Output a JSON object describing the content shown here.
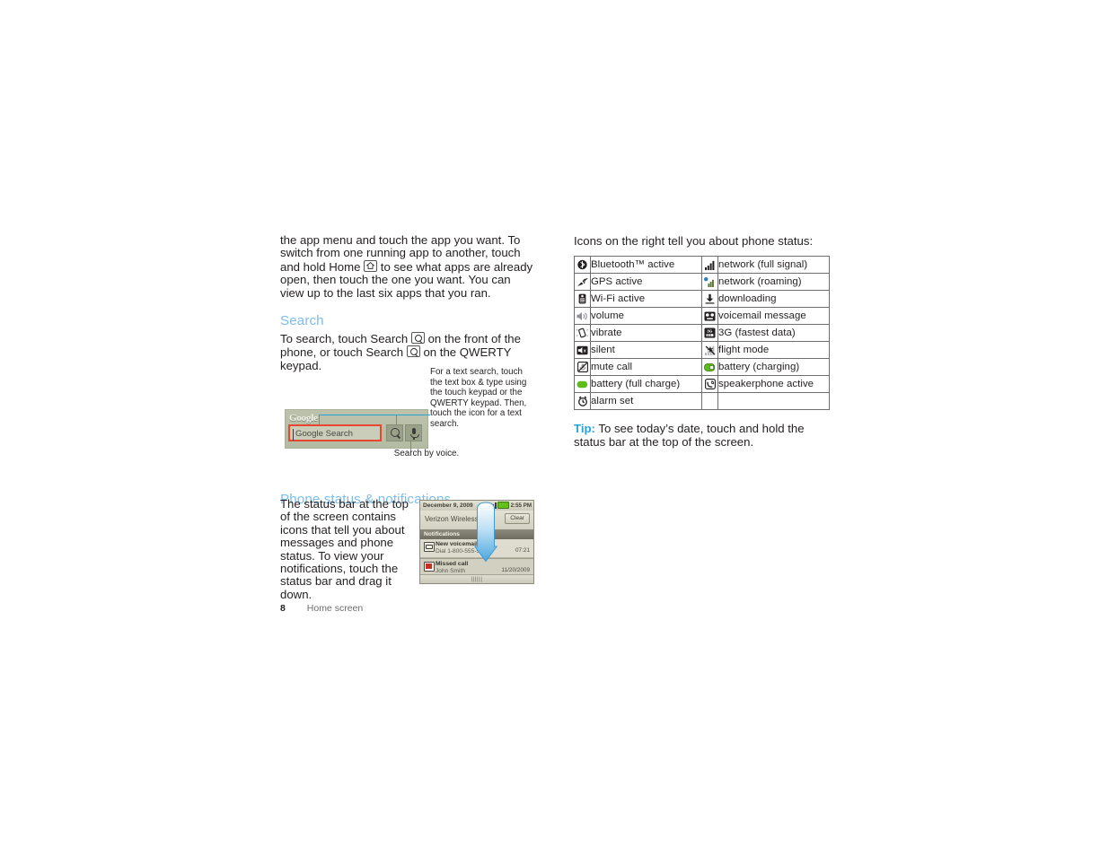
{
  "page": {
    "number": "8",
    "section_label": "Home screen"
  },
  "left": {
    "paragraph_app_menu_part1": "the app menu and touch the app you want. To switch from one running app to another, touch and hold Home",
    "paragraph_app_menu_part2": "to see what apps are already open, then touch the one you want. You can view up to the last six apps that you ran.",
    "search_heading": "Search",
    "paragraph_search_part1": "To search, touch Search",
    "paragraph_search_part2": "on the front of the phone, or touch Search",
    "paragraph_search_part3": "on the QWERTY keypad.",
    "status_heading": "Phone status & notifications",
    "paragraph_status": "The status bar at the top of the screen contains icons that tell you about messages and phone status. To view your notifications, touch the status bar and drag it down."
  },
  "search_widget": {
    "logo": "Google",
    "input_placeholder": "Google Search",
    "search_button_icon": "magnifier-icon",
    "voice_button_icon": "microphone-icon",
    "callout_text": "For a text search, touch the text box & type using the touch keypad or the QWERTY keypad. Then, touch the icon for a text search.",
    "voice_caption": "Search by voice."
  },
  "phone_mockup": {
    "status_date": "December 9, 2009",
    "status_time": "2:55 PM",
    "status_icons": [
      "network-roaming-icon",
      "network-signal-icon",
      "battery-icon"
    ],
    "carrier": "Verizon Wireless",
    "clear_button": "Clear",
    "notifications_header": "Notifications",
    "notifications": [
      {
        "icon": "voicemail-icon",
        "title": "New voicemail",
        "subtitle": "Dial 1-800-555-5555",
        "meta": "07:21"
      },
      {
        "icon": "missed-call-icon",
        "title": "Missed call",
        "subtitle": "John Smith",
        "meta": "11/20/2009"
      }
    ],
    "handle_grip": "||||||",
    "drag_arrow_color": "#4aa8e0"
  },
  "right": {
    "icons_intro": "Icons on the right tell you about phone status:",
    "icon_table": [
      {
        "left_icon": "bluetooth-icon",
        "left_label": "Bluetooth™ active",
        "right_icon": "signal-full-icon",
        "right_label": "network (full signal)"
      },
      {
        "left_icon": "gps-icon",
        "left_label": "GPS active",
        "right_icon": "signal-roaming-icon",
        "right_label": "network (roaming)"
      },
      {
        "left_icon": "wifi-icon",
        "left_label": "Wi-Fi active",
        "right_icon": "download-icon",
        "right_label": "downloading"
      },
      {
        "left_icon": "volume-icon",
        "left_label": "volume",
        "right_icon": "voicemail-icon",
        "right_label": "voicemail message"
      },
      {
        "left_icon": "vibrate-icon",
        "left_label": "vibrate",
        "right_icon": "3g-icon",
        "right_label": "3G (fastest data)"
      },
      {
        "left_icon": "silent-icon",
        "left_label": "silent",
        "right_icon": "flight-mode-icon",
        "right_label": "flight mode"
      },
      {
        "left_icon": "mute-call-icon",
        "left_label": "mute call",
        "right_icon": "battery-charging-icon",
        "right_label": "battery (charging)"
      },
      {
        "left_icon": "battery-full-icon",
        "left_label": "battery (full charge)",
        "right_icon": "speakerphone-icon",
        "right_label": "speakerphone active"
      },
      {
        "left_icon": "alarm-icon",
        "left_label": "alarm set",
        "right_icon": "",
        "right_label": ""
      }
    ],
    "tip_label": "Tip:",
    "tip_text": " To see today’s date, touch and hold the status bar at the top of the screen."
  },
  "colors": {
    "heading_blue": "#7cbdea",
    "accent_blue": "#29a3dc",
    "callout_red": "#e8462f",
    "body_text": "#231f20"
  }
}
